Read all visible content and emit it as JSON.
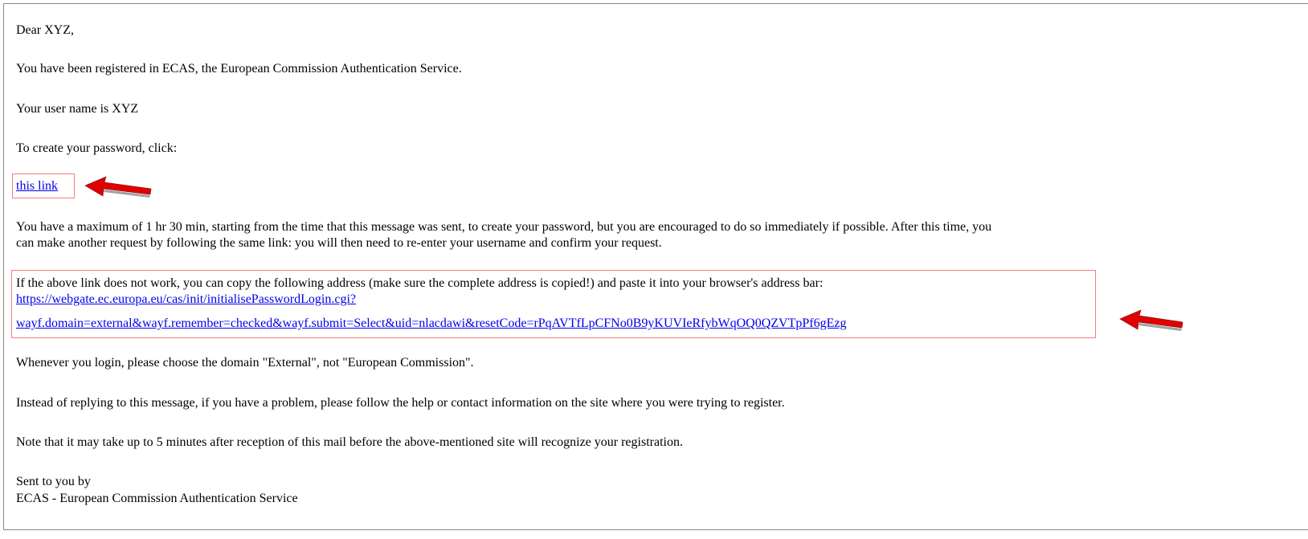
{
  "email": {
    "greeting": "Dear XYZ,",
    "registered": "You have been registered in ECAS, the European Commission Authentication Service.",
    "username_line": "Your user name is XYZ",
    "create_password": "To create your password, click:",
    "password_link": "this link",
    "time_limit_line1": "You have a maximum of 1 hr 30 min, starting from the time that this message was sent, to create your password, but you are encouraged to do so immediately if possible. After this time, you",
    "time_limit_line2": "can make another request by following the same link: you will then need to re-enter your username and confirm your request.",
    "fallback_intro": "If the above link does not work, you can copy the following address (make sure the complete address is copied!) and paste it into your browser's address bar:",
    "fallback_url_line1": "https://webgate.ec.europa.eu/cas/init/initialisePasswordLogin.cgi?",
    "fallback_url_line2": "wayf.domain=external&wayf.remember=checked&wayf.submit=Select&uid=nlacdawi&resetCode=rPqAVTfLpCFNo0B9yKUVIeRfybWqOQ0QZVTpPf6gEzg",
    "domain_note": "Whenever you login, please choose the domain \"External\", not \"European Commission\".",
    "no_reply_note": "Instead of replying to this message, if you have a problem, please follow the help or contact information on the site where you were trying to register.",
    "delay_note": "Note that it may take up to 5 minutes after reception of this mail before the above-mentioned site will recognize your registration.",
    "signoff": "Sent to you by",
    "signature": "ECAS - European Commission Authentication Service"
  },
  "annotations": {
    "highlight_color": "#f08080",
    "arrow_color": "#e00000",
    "link_color": "#0000ee"
  }
}
